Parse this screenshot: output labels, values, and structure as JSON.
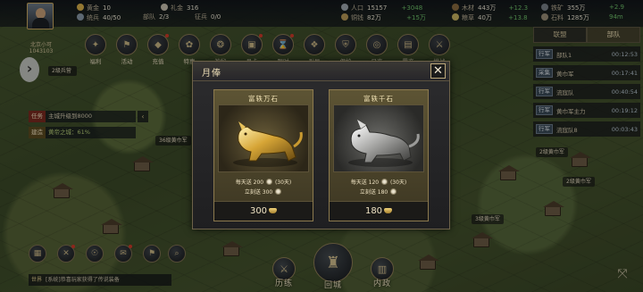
{
  "player": {
    "name": "北京小可",
    "id": "1043103"
  },
  "resources": {
    "gold": {
      "label": "黄金",
      "value": "10"
    },
    "token": {
      "label": "礼金",
      "value": "316"
    },
    "troops": {
      "label": "统兵",
      "value": "40/50"
    },
    "rank": {
      "label": "部队",
      "value": "2/3"
    },
    "order": {
      "label": "征兵",
      "value": "0/0"
    },
    "pop": {
      "label": "人口",
      "value": "15157",
      "delta": "+3048"
    },
    "money": {
      "label": "铜钱",
      "value": "82万",
      "delta": "+15万"
    },
    "wood": {
      "label": "木材",
      "value": "443万",
      "delta": "+12.3"
    },
    "food": {
      "label": "粮草",
      "value": "40万",
      "delta": "+13.8"
    },
    "iron": {
      "label": "铁矿",
      "value": "355万",
      "delta": "+12.3"
    },
    "stone": {
      "label": "石料",
      "value": "1285万",
      "delta": "+12.8"
    },
    "extra1": "+2.9",
    "extra2": "94m"
  },
  "functions": [
    {
      "label": "福利",
      "icon": "gift-icon",
      "glyph": "✦",
      "dot": false
    },
    {
      "label": "活动",
      "icon": "flag-icon",
      "glyph": "⚑",
      "dot": false
    },
    {
      "label": "充值",
      "icon": "treasure-icon",
      "glyph": "◆",
      "dot": true
    },
    {
      "label": "特惠",
      "icon": "sale-icon",
      "glyph": "✿",
      "dot": false
    },
    {
      "label": "神秘",
      "icon": "mystery-icon",
      "glyph": "❂",
      "dot": false
    },
    {
      "label": "月卡",
      "icon": "calendar-icon",
      "glyph": "▣",
      "dot": true
    },
    {
      "label": "限时",
      "icon": "timer-icon",
      "glyph": "⌛",
      "dot": true
    },
    {
      "label": "引导",
      "icon": "guide-icon",
      "glyph": "❖",
      "dot": false
    },
    {
      "label": "保护",
      "icon": "shield-icon",
      "glyph": "⛨",
      "dot": false
    },
    {
      "label": "日充",
      "icon": "coin-icon",
      "glyph": "◎",
      "dot": false
    },
    {
      "label": "累充",
      "icon": "chest-icon",
      "glyph": "▤",
      "dot": false
    },
    {
      "label": "挑战",
      "icon": "sword-icon",
      "glyph": "⚔",
      "dot": false
    }
  ],
  "left": {
    "march_tag": "2级兵营",
    "task_label": "任务",
    "task_text": "主城升级到8000",
    "busy_label": "建造",
    "busy_text": "黄帝之城：61%"
  },
  "right_panel": {
    "tabs": [
      "联盟",
      "部队"
    ],
    "rows": [
      {
        "badge": "行军",
        "name": "部队1",
        "time": "00:12:53"
      },
      {
        "badge": "采集",
        "name": "黄巾军",
        "time": "00:17:41"
      },
      {
        "badge": "行军",
        "name": "流寇队",
        "time": "00:40:54"
      },
      {
        "badge": "行军",
        "name": "黄巾军主力",
        "time": "00:19:12"
      },
      {
        "badge": "行军",
        "name": "流寇队8",
        "time": "00:03:43"
      }
    ]
  },
  "map_labels": [
    "36级黄巾军",
    "2级黄巾军",
    "2级黄巾军",
    "3级黄巾军"
  ],
  "chat": {
    "channel": "世界",
    "text": "[系统]恭喜玩家获得了传说装备"
  },
  "bottom_buttons": {
    "battle": "历练",
    "city": "回城",
    "politics": "内政"
  },
  "modal": {
    "title": "月俸",
    "cards": [
      {
        "name": "富轶万石",
        "variant": "gold",
        "daily_prefix": "每天送",
        "daily_amount": "200",
        "days": "(30天)",
        "instant_prefix": "立刻送",
        "instant_amount": "300",
        "price": "300"
      },
      {
        "name": "富轶千石",
        "variant": "silver",
        "daily_prefix": "每天送",
        "daily_amount": "120",
        "days": "(30天)",
        "instant_prefix": "立刻送",
        "instant_amount": "180",
        "price": "180"
      }
    ]
  }
}
